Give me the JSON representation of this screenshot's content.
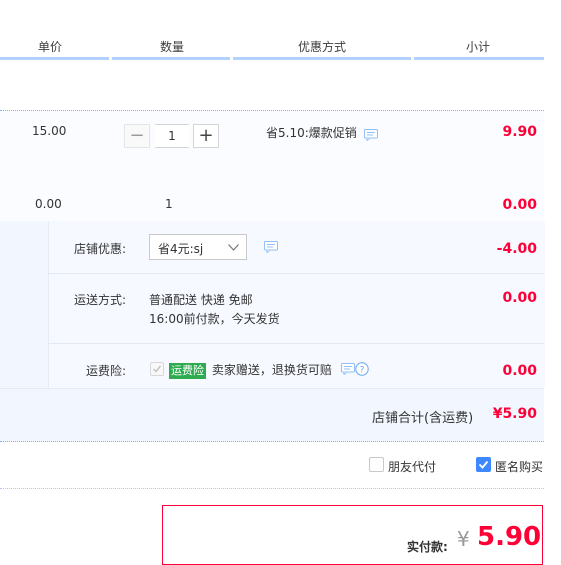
{
  "header": {
    "unit_price": "单价",
    "quantity": "数量",
    "discount": "优惠方式",
    "subtotal": "小计"
  },
  "item": {
    "unit_price": "15.00",
    "quantity": "1",
    "minus": "−",
    "plus": "+",
    "discount_text": "省5.10:爆款促销",
    "subtotal": "9.90"
  },
  "gift_item": {
    "unit_price": "0.00",
    "quantity": "1",
    "subtotal": "0.00"
  },
  "shop": {
    "coupon_label": "店铺优惠:",
    "coupon_selected": "省4元:sj",
    "coupon_amount": "-4.00",
    "shipping_label": "运送方式:",
    "shipping_line1": "普通配送 快递 免邮",
    "shipping_line2": "16:00前付款，今天发货",
    "shipping_amount": "0.00",
    "insurance_label": "运费险:",
    "insurance_badge": "运费险",
    "insurance_text": "卖家赠送，退换货可赔",
    "insurance_amount": "0.00",
    "total_label": "店铺合计(含运费)",
    "total_value": "¥5.90"
  },
  "options": {
    "friend_pay": "朋友代付",
    "anonymous": "匿名购买"
  },
  "payment": {
    "label": "实付款:",
    "currency": "¥",
    "amount": "5.90"
  },
  "colors": {
    "price_red": "#ff0036",
    "accent_blue": "#3d88ff",
    "badge_green": "#2eab50"
  }
}
